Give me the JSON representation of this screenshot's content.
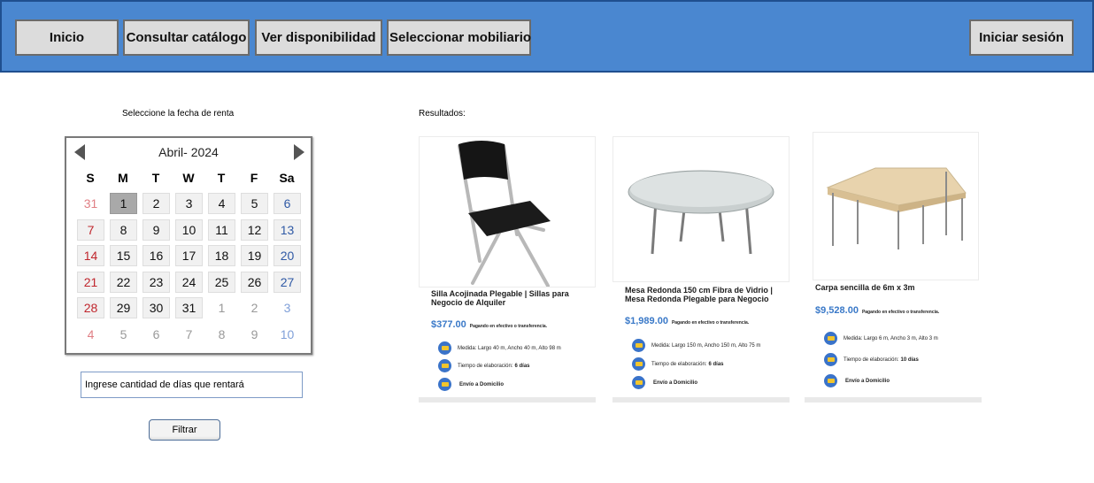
{
  "nav": {
    "inicio": "Inicio",
    "catalogo": "Consultar catálogo",
    "disponibilidad": "Ver disponibilidad",
    "seleccionar": "Seleccionar mobiliario",
    "login": "Iniciar sesión"
  },
  "date_label": "Seleccione la fecha de renta",
  "results_label": "Resultados:",
  "calendar": {
    "title": "Abril- 2024",
    "weekdays": [
      "S",
      "M",
      "T",
      "W",
      "T",
      "F",
      "Sa"
    ],
    "selected_day": "1",
    "weeks": [
      [
        "31",
        "1",
        "2",
        "3",
        "4",
        "5",
        "6"
      ],
      [
        "7",
        "8",
        "9",
        "10",
        "11",
        "12",
        "13"
      ],
      [
        "14",
        "15",
        "16",
        "17",
        "18",
        "19",
        "20"
      ],
      [
        "21",
        "22",
        "23",
        "24",
        "25",
        "26",
        "27"
      ],
      [
        "28",
        "29",
        "30",
        "31",
        "1",
        "2",
        "3"
      ],
      [
        "4",
        "5",
        "6",
        "7",
        "8",
        "9",
        "10"
      ]
    ]
  },
  "days_input": {
    "placeholder": "Ingrese cantidad de días que rentará"
  },
  "filter_button": "Filtrar",
  "products": [
    {
      "name": "Silla Acojinada Plegable | Sillas para Negocio de Alquiler",
      "price": "$377.00",
      "payment": "Pagando en efectivo o transferencia.",
      "medida": "Medida: Largo 40 m, Ancho 40 m, Alto 98 m",
      "tiempo_label": "Tiempo de elaboración:",
      "tiempo_value": "6 días",
      "envio": "Envío a Domicilio"
    },
    {
      "name": "Mesa Redonda 150 cm Fibra de Vidrio | Mesa Redonda Plegable para Negocio",
      "price": "$1,989.00",
      "payment": "Pagando en efectivo o transferencia.",
      "medida": "Medida: Largo 150 m, Ancho 150 m, Alto 75 m",
      "tiempo_label": "Tiempo de elaboración:",
      "tiempo_value": "6 días",
      "envio": "Envío a Domicilio"
    },
    {
      "name": "Carpa sencilla de 6m x 3m",
      "price": "$9,528.00",
      "payment": "Pagando en efectivo o transferencia.",
      "medida": "Medida: Largo 6 m, Ancho 3 m, Alto 3 m",
      "tiempo_label": "Tiempo de elaboración:",
      "tiempo_value": "10 días",
      "envio": "Envío a Domicilio"
    }
  ]
}
